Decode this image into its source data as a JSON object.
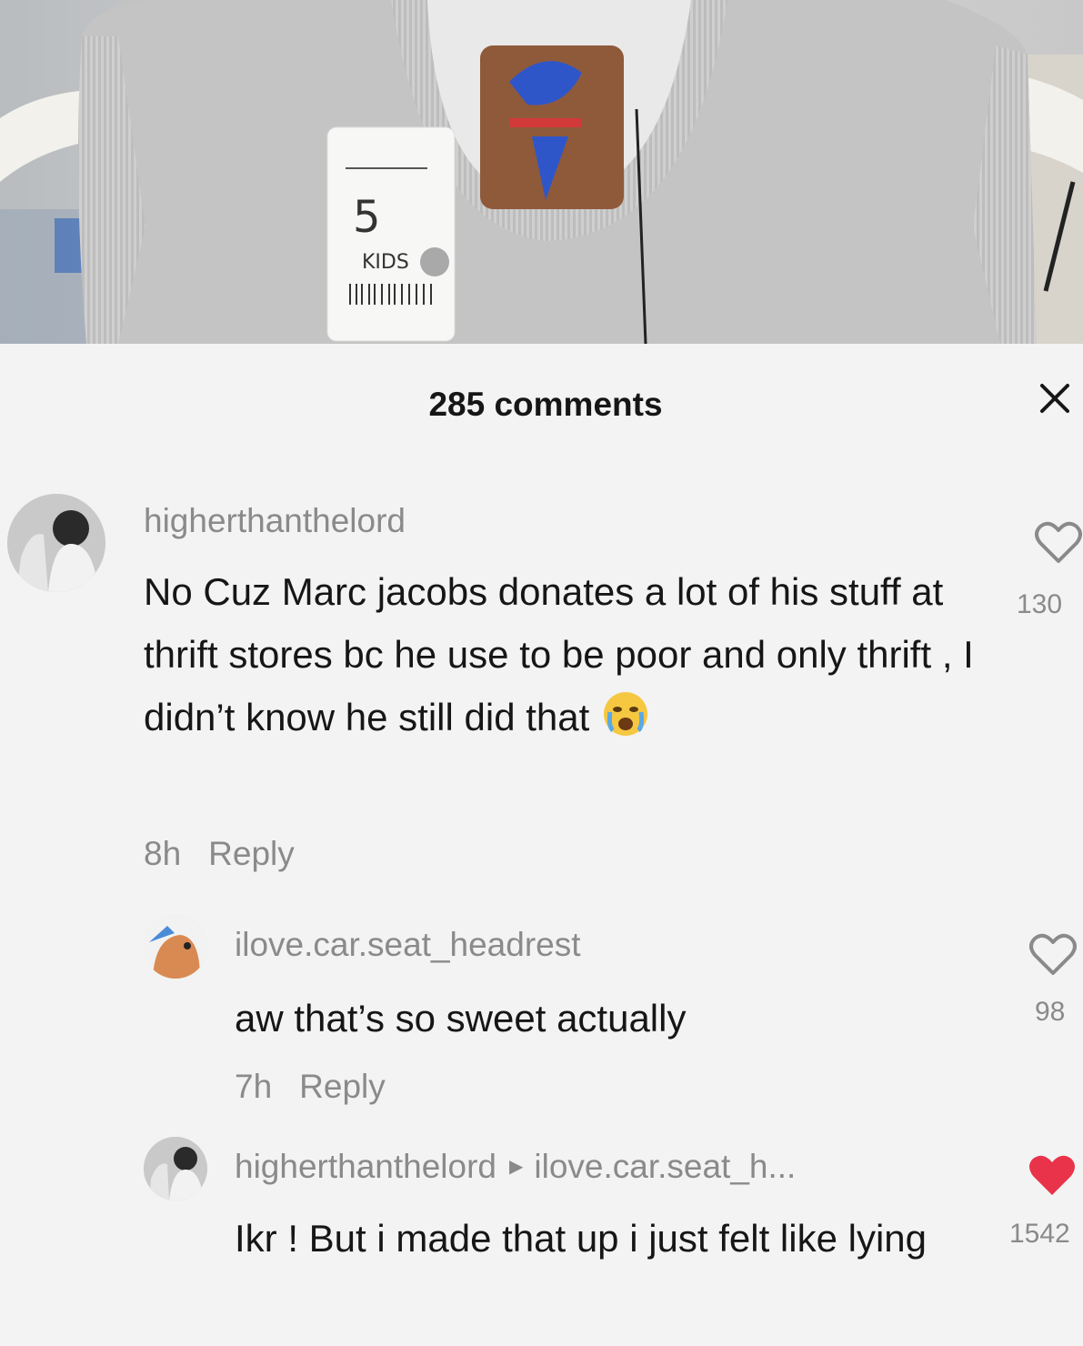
{
  "photo": {
    "tag_price": "5",
    "tag_label": "KIDS"
  },
  "header": {
    "comment_count_label": "285 comments",
    "close_icon": "close-icon"
  },
  "comments": [
    {
      "username": "higherthanthelord",
      "text": "No Cuz Marc jacobs donates a lot of his stuff at thrift stores bc he use to be poor and only thrift , I didn’t know he still did that",
      "emoji_icon": "crying-face-icon",
      "time": "8h",
      "reply_label": "Reply",
      "likes": "130",
      "liked": false
    },
    {
      "username": "ilove.car.seat_headrest",
      "text": "aw that’s so sweet actually",
      "time": "7h",
      "reply_label": "Reply",
      "likes": "98",
      "liked": false
    },
    {
      "username": "higherthanthelord",
      "reply_to": "ilove.car.seat_h...",
      "text": "Ikr ! But i made that up i just felt like lying",
      "likes": "1542",
      "liked": true,
      "like_color": "#e8334a"
    }
  ]
}
